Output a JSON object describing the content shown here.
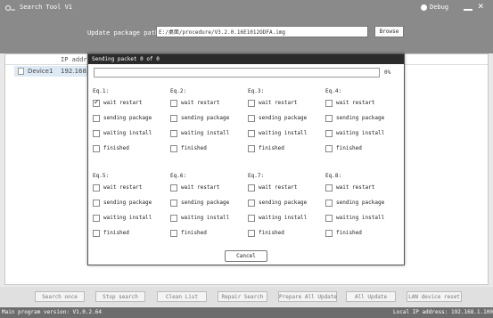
{
  "app": {
    "title": "Search Tool V1",
    "debug_label": "Debug",
    "close_glyph": "×"
  },
  "package": {
    "label": "Update package path:",
    "path_value": "E:/桌面/procedure/V3.2.0.16E1012ODFA.img",
    "browse_label": "Browse"
  },
  "device_list": {
    "ip_header": "IP address",
    "rows": [
      {
        "name": "Device1",
        "ip": "192.168.1"
      }
    ]
  },
  "dialog": {
    "title": "Sending packet 0 of 0",
    "progress_percent": 0,
    "progress_text": "0%",
    "cancel_label": "Cancel",
    "eq_groups": [
      {
        "label": "Eq.1:",
        "states": [
          {
            "text": "wait restart",
            "checked": true
          },
          {
            "text": "sending package",
            "checked": false
          },
          {
            "text": "waiting install",
            "checked": false
          },
          {
            "text": "finished",
            "checked": false
          }
        ]
      },
      {
        "label": "Eq.2:",
        "states": [
          {
            "text": "wait restart",
            "checked": false
          },
          {
            "text": "sending package",
            "checked": false
          },
          {
            "text": "waiting install",
            "checked": false
          },
          {
            "text": "finished",
            "checked": false
          }
        ]
      },
      {
        "label": "Eq.3:",
        "states": [
          {
            "text": "wait restart",
            "checked": false
          },
          {
            "text": "sending package",
            "checked": false
          },
          {
            "text": "waiting install",
            "checked": false
          },
          {
            "text": "finished",
            "checked": false
          }
        ]
      },
      {
        "label": "Eq.4:",
        "states": [
          {
            "text": "wait restart",
            "checked": false
          },
          {
            "text": "sending package",
            "checked": false
          },
          {
            "text": "waiting install",
            "checked": false
          },
          {
            "text": "finished",
            "checked": false
          }
        ]
      },
      {
        "label": "Eq.5:",
        "states": [
          {
            "text": "wait restart",
            "checked": false
          },
          {
            "text": "sending package",
            "checked": false
          },
          {
            "text": "waiting install",
            "checked": false
          },
          {
            "text": "finished",
            "checked": false
          }
        ]
      },
      {
        "label": "Eq.6:",
        "states": [
          {
            "text": "wait restart",
            "checked": false
          },
          {
            "text": "sending package",
            "checked": false
          },
          {
            "text": "waiting install",
            "checked": false
          },
          {
            "text": "finished",
            "checked": false
          }
        ]
      },
      {
        "label": "Eq.7:",
        "states": [
          {
            "text": "wait restart",
            "checked": false
          },
          {
            "text": "sending package",
            "checked": false
          },
          {
            "text": "waiting install",
            "checked": false
          },
          {
            "text": "finished",
            "checked": false
          }
        ]
      },
      {
        "label": "Eq.8:",
        "states": [
          {
            "text": "wait restart",
            "checked": false
          },
          {
            "text": "sending package",
            "checked": false
          },
          {
            "text": "waiting install",
            "checked": false
          },
          {
            "text": "finished",
            "checked": false
          }
        ]
      }
    ]
  },
  "toolbar": {
    "buttons": [
      "Search once",
      "Stop search",
      "Clean List",
      "Repair Search",
      "Prepare All Update",
      "All Update",
      "LAN device reset"
    ]
  },
  "status": {
    "version": "Main program version: V1.0.2.64",
    "local_ip": "Local IP address: 192.168.1.100"
  },
  "colors": {
    "titlebar": "#8a8a8a",
    "dialog_title": "#2b2b2b",
    "statusbar": "#6d6d6d",
    "selection": "#dde9f5"
  }
}
